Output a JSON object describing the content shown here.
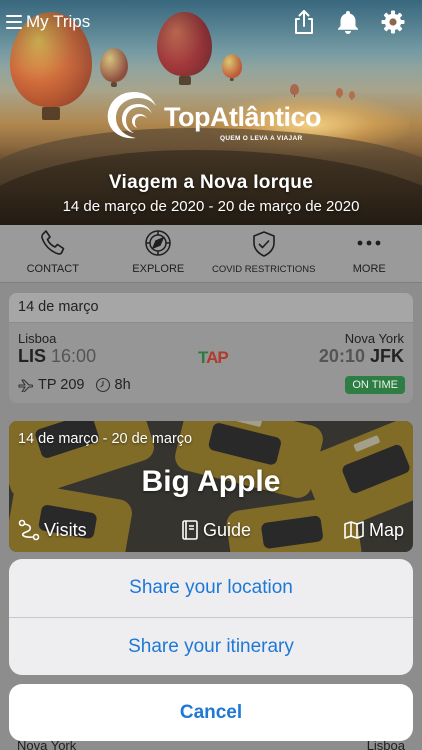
{
  "topbar": {
    "menu_label": "My Trips"
  },
  "logo": {
    "name": "TopAtlântico",
    "tagline": "QUEM O LEVA A VIAJAR"
  },
  "trip": {
    "title": "Viagem a Nova Iorque",
    "dates": "14 de março de 2020 - 20 de março de 2020"
  },
  "actions": [
    {
      "label": "CONTACT",
      "icon": "phone-icon"
    },
    {
      "label": "EXPLORE",
      "icon": "compass-icon"
    },
    {
      "label": "COVID RESTRICTIONS",
      "icon": "shield-check-icon"
    },
    {
      "label": "MORE",
      "icon": "more-dots-icon"
    }
  ],
  "flight": {
    "date": "14 de março",
    "from_city": "Lisboa",
    "from_code": "LIS",
    "departure": "16:00",
    "to_city": "Nova York",
    "to_code": "JFK",
    "arrival": "20:10",
    "airline": "TAP",
    "flight_number": "TP 209",
    "duration": "8h",
    "status": "ON TIME"
  },
  "city": {
    "dates": "14 de março - 20 de março",
    "name": "Big Apple",
    "links": {
      "visits": "Visits",
      "guide": "Guide",
      "map": "Map"
    }
  },
  "peek": {
    "left": "Nova York",
    "right": "Lisboa"
  },
  "sheet": {
    "share_location": "Share your location",
    "share_itinerary": "Share your itinerary",
    "cancel": "Cancel"
  },
  "colors": {
    "accent": "#1e78d6",
    "status_green": "#2e7d45",
    "overlay": "#8d8d8d"
  }
}
